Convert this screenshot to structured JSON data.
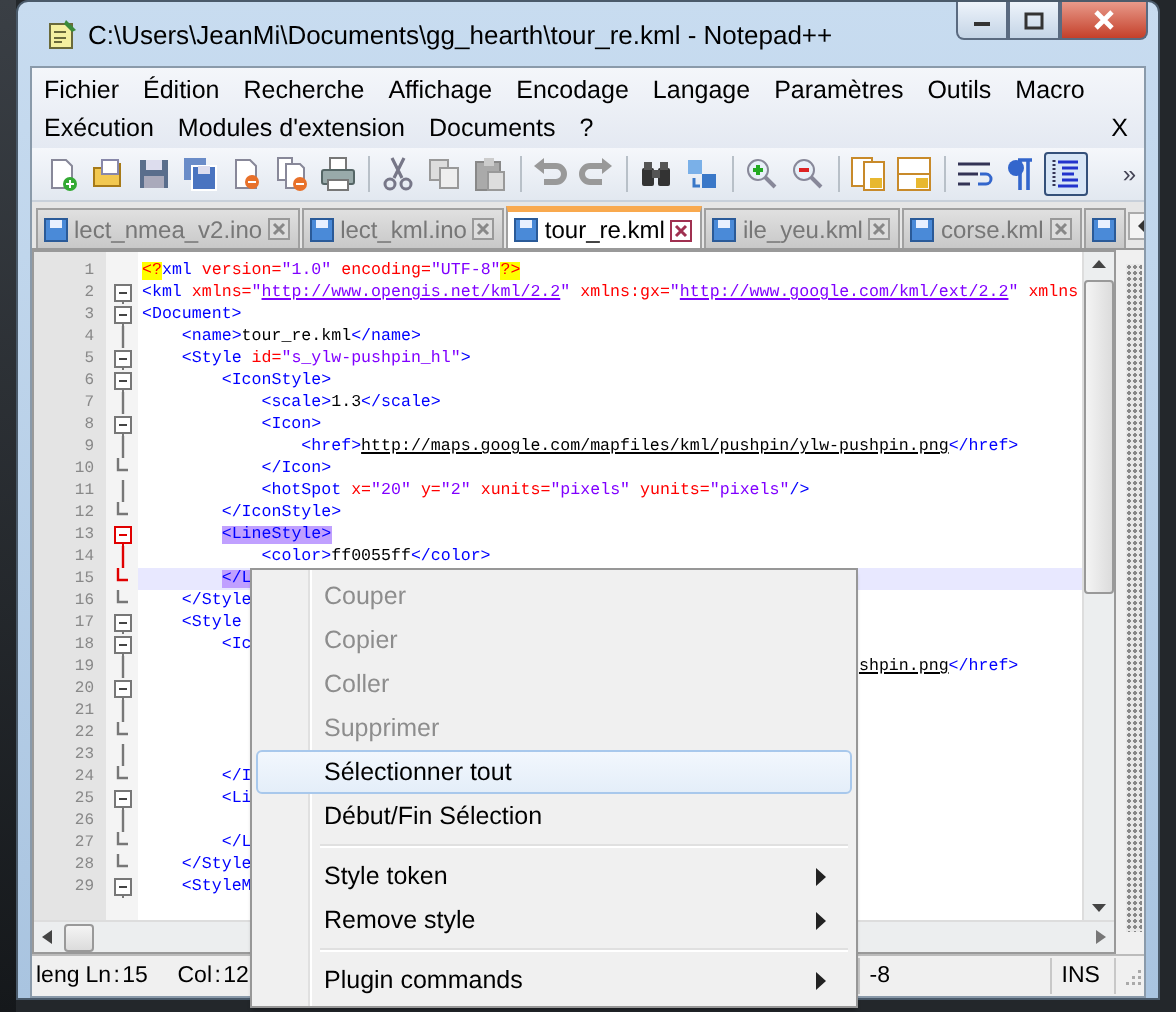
{
  "window": {
    "title": "C:\\Users\\JeanMi\\Documents\\gg_hearth\\tour_re.kml - Notepad++"
  },
  "menu_bar": {
    "items": [
      "Fichier",
      "Édition",
      "Recherche",
      "Affichage",
      "Encodage",
      "Langage",
      "Paramètres",
      "Outils",
      "Macro",
      "Exécution",
      "Modules d'extension",
      "Documents",
      "?"
    ],
    "close": "X"
  },
  "toolbar": {
    "buttons": [
      {
        "kind": "new",
        "pressed": false
      },
      {
        "kind": "open",
        "pressed": false
      },
      {
        "kind": "save",
        "pressed": false
      },
      {
        "kind": "saveall",
        "pressed": false
      },
      {
        "kind": "close",
        "pressed": false
      },
      {
        "kind": "closeall",
        "pressed": false
      },
      {
        "kind": "print",
        "pressed": false
      },
      {
        "kind": "sep"
      },
      {
        "kind": "cut",
        "pressed": false
      },
      {
        "kind": "copy",
        "pressed": false
      },
      {
        "kind": "paste",
        "pressed": false
      },
      {
        "kind": "sep"
      },
      {
        "kind": "undo",
        "pressed": false
      },
      {
        "kind": "redo",
        "pressed": false
      },
      {
        "kind": "sep"
      },
      {
        "kind": "find",
        "pressed": false
      },
      {
        "kind": "replace",
        "pressed": false
      },
      {
        "kind": "sep"
      },
      {
        "kind": "zoomin",
        "pressed": false
      },
      {
        "kind": "zoomout",
        "pressed": false
      },
      {
        "kind": "sep"
      },
      {
        "kind": "syncv",
        "pressed": false
      },
      {
        "kind": "synch",
        "pressed": false
      },
      {
        "kind": "sep"
      },
      {
        "kind": "wrap",
        "pressed": false
      },
      {
        "kind": "pilcrow",
        "pressed": false
      },
      {
        "kind": "guide",
        "pressed": true
      }
    ],
    "overflow": "»"
  },
  "tabs": [
    {
      "label": "lect_nmea_v2.ino",
      "selected": false
    },
    {
      "label": "lect_kml.ino",
      "selected": false
    },
    {
      "label": "tour_re.kml",
      "selected": true
    },
    {
      "label": "ile_yeu.kml",
      "selected": false
    },
    {
      "label": "corse.kml",
      "selected": false
    },
    {
      "selected": false
    }
  ],
  "editor": {
    "lines": [
      {
        "number": "1",
        "active": false,
        "current": false,
        "tokens": [
          {
            "kind": "pi",
            "text": "<?"
          },
          {
            "kind": "tag",
            "text": "xml"
          },
          {
            "kind": "attr",
            "text": " version="
          },
          {
            "kind": "value",
            "text": "\"1.0\""
          },
          {
            "kind": "attr",
            "text": " encoding="
          },
          {
            "kind": "value",
            "text": "\"UTF-8\""
          },
          {
            "kind": "pi",
            "text": "?>"
          }
        ]
      },
      {
        "number": "2",
        "kind": "fold-start",
        "active": false,
        "current": false,
        "tokens": [
          {
            "kind": "tag",
            "text": "<kml"
          },
          {
            "kind": "attr",
            "text": " xmlns="
          },
          {
            "kind": "value",
            "text": "\""
          },
          {
            "kind": "url",
            "text": "http://www.opengis.net/kml/2.2"
          },
          {
            "kind": "value",
            "text": "\""
          },
          {
            "kind": "attr",
            "text": " xmlns:gx="
          },
          {
            "kind": "value",
            "text": "\""
          },
          {
            "kind": "url",
            "text": "http://www.google.com/kml/ext/2.2"
          },
          {
            "kind": "value",
            "text": "\""
          },
          {
            "kind": "attr",
            "text": " xmlns"
          }
        ]
      },
      {
        "number": "3",
        "kind": "fold-start",
        "active": false,
        "current": false,
        "tokens": [
          {
            "kind": "tag",
            "text": "<Document>"
          }
        ]
      },
      {
        "number": "4",
        "kind": "fold-body",
        "active": false,
        "current": false,
        "tokens": [
          {
            "kind": "tag",
            "text": "    <name>"
          },
          {
            "kind": "text",
            "text": "tour_re.kml"
          },
          {
            "kind": "tag",
            "text": "</name>"
          }
        ]
      },
      {
        "number": "5",
        "kind": "fold-start",
        "active": false,
        "current": false,
        "tokens": [
          {
            "kind": "tag",
            "text": "    <Style"
          },
          {
            "kind": "attr",
            "text": " id="
          },
          {
            "kind": "value",
            "text": "\"s_ylw-pushpin_hl\""
          },
          {
            "kind": "tag",
            "text": ">"
          }
        ]
      },
      {
        "number": "6",
        "kind": "fold-start",
        "active": false,
        "current": false,
        "tokens": [
          {
            "kind": "tag",
            "text": "        <IconStyle>"
          }
        ]
      },
      {
        "number": "7",
        "kind": "fold-body",
        "active": false,
        "current": false,
        "tokens": [
          {
            "kind": "tag",
            "text": "            <scale>"
          },
          {
            "kind": "text",
            "text": "1.3"
          },
          {
            "kind": "tag",
            "text": "</scale>"
          }
        ]
      },
      {
        "number": "8",
        "kind": "fold-start",
        "active": false,
        "current": false,
        "tokens": [
          {
            "kind": "tag",
            "text": "            <Icon>"
          }
        ]
      },
      {
        "number": "9",
        "kind": "fold-body",
        "active": false,
        "current": false,
        "tokens": [
          {
            "kind": "tag",
            "text": "                <href>"
          },
          {
            "kind": "link",
            "text": "http://maps.google.com/mapfiles/kml/pushpin/ylw-pushpin.png"
          },
          {
            "kind": "tag",
            "text": "</href>"
          }
        ]
      },
      {
        "number": "10",
        "kind": "fold-end",
        "active": false,
        "current": false,
        "tokens": [
          {
            "kind": "tag",
            "text": "            </Icon>"
          }
        ]
      },
      {
        "number": "11",
        "kind": "fold-body",
        "active": false,
        "current": false,
        "tokens": [
          {
            "kind": "tag",
            "text": "            <hotSpot"
          },
          {
            "kind": "attr",
            "text": " x="
          },
          {
            "kind": "value",
            "text": "\"20\""
          },
          {
            "kind": "attr",
            "text": " y="
          },
          {
            "kind": "value",
            "text": "\"2\""
          },
          {
            "kind": "attr",
            "text": " xunits="
          },
          {
            "kind": "value",
            "text": "\"pixels\""
          },
          {
            "kind": "attr",
            "text": " yunits="
          },
          {
            "kind": "value",
            "text": "\"pixels\""
          },
          {
            "kind": "tag",
            "text": "/>"
          }
        ]
      },
      {
        "number": "12",
        "kind": "fold-end",
        "active": false,
        "current": false,
        "tokens": [
          {
            "kind": "tag",
            "text": "        </IconStyle>"
          }
        ]
      },
      {
        "number": "13",
        "kind": "fold-start",
        "active": true,
        "current": false,
        "tokens": [
          {
            "kind": "match",
            "text": "        <LineStyle>"
          }
        ]
      },
      {
        "number": "14",
        "kind": "fold-body",
        "active": true,
        "current": false,
        "tokens": [
          {
            "kind": "tag",
            "text": "            <color>"
          },
          {
            "kind": "text",
            "text": "ff0055ff"
          },
          {
            "kind": "tag",
            "text": "</color>"
          }
        ]
      },
      {
        "number": "15",
        "kind": "fold-end",
        "active": true,
        "current": true,
        "tokens": [
          {
            "kind": "match",
            "text": "        </L"
          }
        ]
      },
      {
        "number": "16",
        "kind": "fold-end",
        "active": false,
        "current": false,
        "tokens": [
          {
            "kind": "tag",
            "text": "    </Style"
          }
        ]
      },
      {
        "number": "17",
        "kind": "fold-start",
        "active": false,
        "current": false,
        "tokens": [
          {
            "kind": "tag",
            "text": "    <Style"
          }
        ]
      },
      {
        "number": "18",
        "kind": "fold-start",
        "active": false,
        "current": false,
        "tokens": [
          {
            "kind": "tag",
            "text": "        <Ic"
          }
        ]
      },
      {
        "number": "19",
        "kind": "fold-body",
        "active": false,
        "current": false,
        "tokens": [
          {
            "kind": "link",
            "text": "                                                                        shpin.png"
          },
          {
            "kind": "tag",
            "text": "</href>"
          }
        ]
      },
      {
        "number": "20",
        "kind": "fold-start",
        "active": false,
        "current": false
      },
      {
        "number": "21",
        "kind": "fold-body",
        "active": false,
        "current": false
      },
      {
        "number": "22",
        "kind": "fold-end",
        "active": false,
        "current": false
      },
      {
        "number": "23",
        "kind": "fold-body",
        "active": false,
        "current": false
      },
      {
        "number": "24",
        "kind": "fold-end",
        "active": false,
        "current": false,
        "tokens": [
          {
            "kind": "tag",
            "text": "        </I"
          }
        ]
      },
      {
        "number": "25",
        "kind": "fold-start",
        "active": false,
        "current": false,
        "tokens": [
          {
            "kind": "tag",
            "text": "        <Li"
          }
        ]
      },
      {
        "number": "26",
        "kind": "fold-body",
        "active": false,
        "current": false
      },
      {
        "number": "27",
        "kind": "fold-end",
        "active": false,
        "current": false,
        "tokens": [
          {
            "kind": "tag",
            "text": "        </L"
          }
        ]
      },
      {
        "number": "28",
        "kind": "fold-end",
        "active": false,
        "current": false,
        "tokens": [
          {
            "kind": "tag",
            "text": "    </Style"
          }
        ]
      },
      {
        "number": "29",
        "kind": "fold-start",
        "active": false,
        "current": false,
        "tokens": [
          {
            "kind": "tag",
            "text": "    <StyleM"
          }
        ]
      }
    ]
  },
  "status_bar": {
    "fields": [
      "leng",
      "Ln : 15",
      "Col : 12",
      "-8",
      "INS"
    ]
  },
  "context_menu": {
    "items": [
      {
        "kind": "item",
        "label": "Couper",
        "disabled": true,
        "selected": false,
        "submenu": false
      },
      {
        "kind": "item",
        "label": "Copier",
        "disabled": true,
        "selected": false,
        "submenu": false
      },
      {
        "kind": "item",
        "label": "Coller",
        "disabled": true,
        "selected": false,
        "submenu": false
      },
      {
        "kind": "item",
        "label": "Supprimer",
        "disabled": true,
        "selected": false,
        "submenu": false
      },
      {
        "kind": "item",
        "label": "Sélectionner tout",
        "disabled": false,
        "selected": true,
        "submenu": false
      },
      {
        "kind": "item",
        "label": "Début/Fin Sélection",
        "disabled": false,
        "selected": false,
        "submenu": false
      },
      {
        "kind": "separator"
      },
      {
        "kind": "item",
        "label": "Style token",
        "disabled": false,
        "selected": false,
        "submenu": true
      },
      {
        "kind": "item",
        "label": "Remove style",
        "disabled": false,
        "selected": false,
        "submenu": true
      },
      {
        "kind": "separator"
      },
      {
        "kind": "item",
        "label": "Plugin commands",
        "disabled": false,
        "selected": false,
        "submenu": true
      }
    ]
  }
}
